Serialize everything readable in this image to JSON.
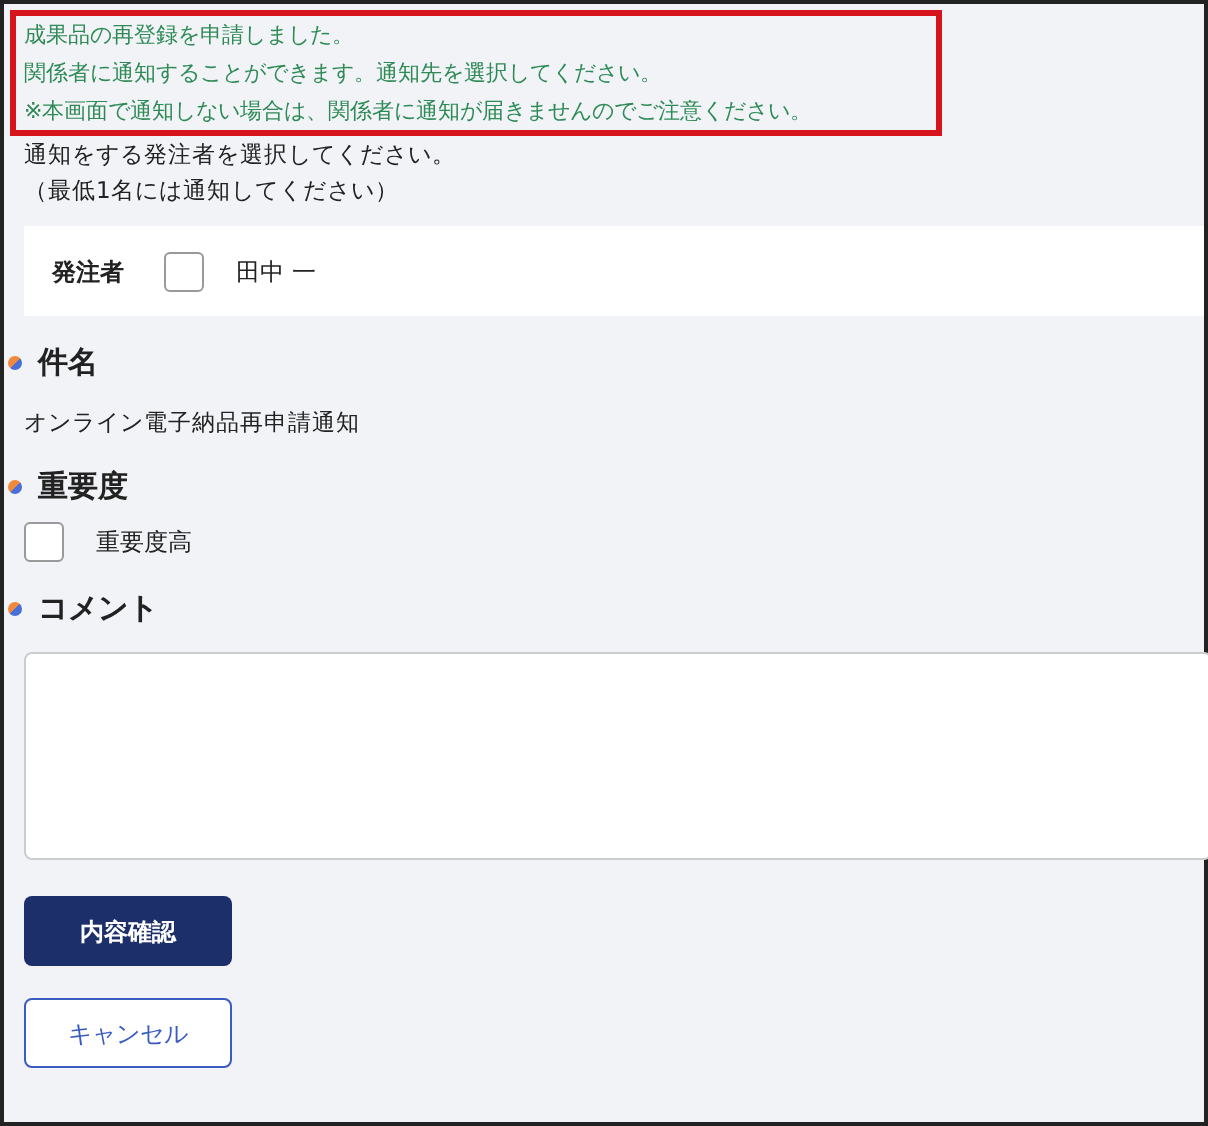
{
  "notice": {
    "lines": [
      "成果品の再登録を申請しました。",
      "関係者に通知することができます。通知先を選択してください。",
      "※本画面で通知しない場合は、関係者に通知が届きませんのでご注意ください。"
    ]
  },
  "instructions": [
    "通知をする発注者を選択してください。",
    "（最低1名には通知してください）"
  ],
  "recipients": {
    "label": "発注者",
    "items": [
      {
        "name": "田中 一",
        "checked": false
      }
    ]
  },
  "sections": [
    {
      "kind": "text",
      "heading": "件名",
      "value": "オンライン電子納品再申請通知"
    },
    {
      "kind": "checkbox",
      "heading": "重要度",
      "label": "重要度高",
      "checked": false
    },
    {
      "kind": "textarea",
      "heading": "コメント"
    }
  ],
  "buttons": [
    {
      "kind": "primary",
      "label": "内容確認"
    },
    {
      "kind": "outline",
      "label": "キャンセル"
    }
  ]
}
